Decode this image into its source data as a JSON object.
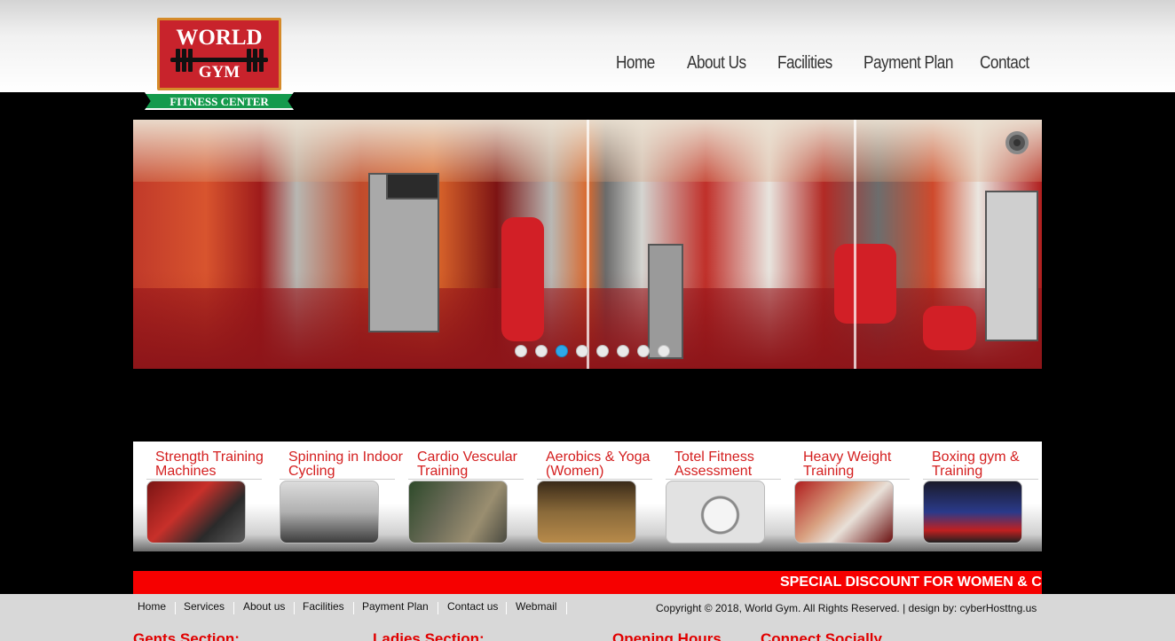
{
  "brand": {
    "logo_line1": "WORLD",
    "logo_line2": "GYM",
    "logo_ribbon": "FITNESS CENTER",
    "colors": {
      "logo_red": "#c8232c",
      "ribbon_green": "#149a4d",
      "accent_red": "#f60000"
    }
  },
  "nav": {
    "items": [
      {
        "label": "Home"
      },
      {
        "label": "About Us"
      },
      {
        "label": "Facilities"
      },
      {
        "label": "Payment Plan"
      },
      {
        "label": "Contact"
      }
    ]
  },
  "slider": {
    "dot_count": 8,
    "active_index": 2,
    "pause_icon": "pause-icon"
  },
  "services": [
    {
      "title": "Strength Training Machines",
      "icon": "strength-training-photo"
    },
    {
      "title": "Spinning in Indoor Cycling",
      "icon": "indoor-cycling-photo"
    },
    {
      "title": "Cardio Vescular Training",
      "icon": "treadmill-photo"
    },
    {
      "title": "Aerobics & Yoga (Women)",
      "icon": "aerobics-photo"
    },
    {
      "title": "Totel Fitness Assessment",
      "icon": "scale-photo"
    },
    {
      "title": "Heavy Weight Training",
      "icon": "weight-training-photo"
    },
    {
      "title": "Boxing gym & Training",
      "icon": "boxing-photo"
    }
  ],
  "ticker": {
    "text": "SPECIAL DISCOUNT FOR WOMEN & C"
  },
  "footer": {
    "nav": [
      {
        "label": "Home"
      },
      {
        "label": "Services"
      },
      {
        "label": "About us"
      },
      {
        "label": "Facilities"
      },
      {
        "label": "Payment Plan"
      },
      {
        "label": "Contact us"
      },
      {
        "label": "Webmail"
      }
    ],
    "copyright": "Copyright © 2018, World Gym. All Rights Reserved. | design by: cyberHosttng.us",
    "sections": [
      {
        "heading": "Gents Section:"
      },
      {
        "heading": "Ladies Section:"
      },
      {
        "heading": "Opening Hours"
      },
      {
        "heading": "Connect Socially"
      }
    ]
  }
}
